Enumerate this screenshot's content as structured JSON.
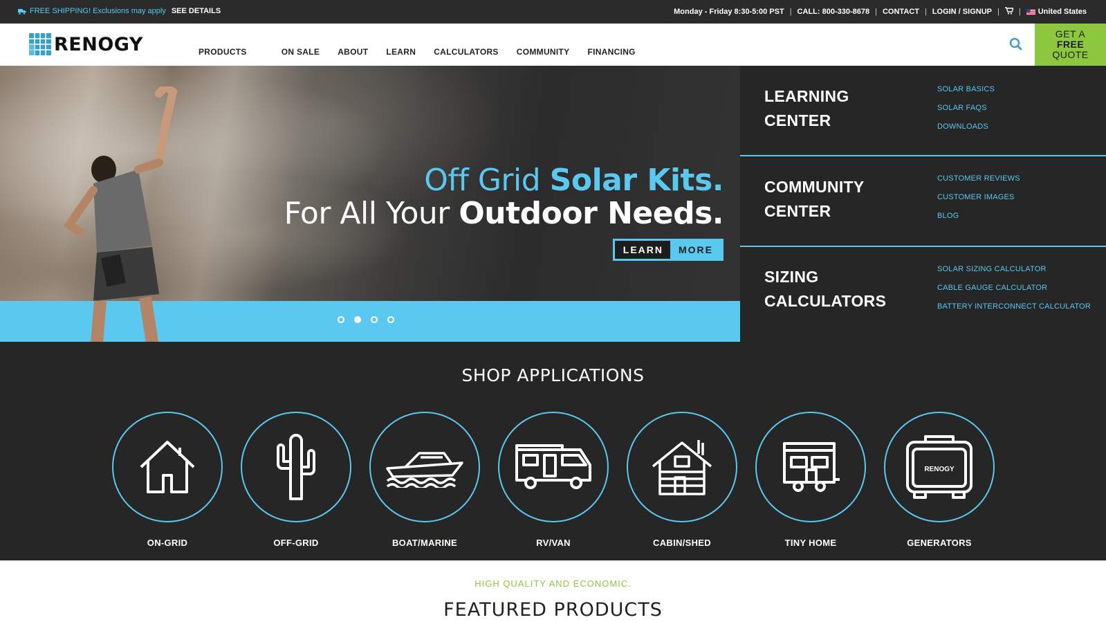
{
  "topbar": {
    "shipping_text": "FREE SHIPPING! Exclusions may apply",
    "details_link": "SEE DETAILS",
    "hours": "Monday - Friday 8:30-5:00 PST",
    "phone": "CALL: 800-330-8678",
    "contact": "CONTACT",
    "login": "LOGIN / SIGNUP",
    "country": "United States",
    "separator": "|"
  },
  "header": {
    "logo_text": "RENOGY",
    "nav": [
      "PRODUCTS",
      "ON SALE",
      "ABOUT",
      "LEARN",
      "CALCULATORS",
      "COMMUNITY",
      "FINANCING"
    ],
    "quote": {
      "line1": "GET A",
      "line2": "FREE",
      "line3": "QUOTE"
    }
  },
  "hero": {
    "line1_light": "Off Grid ",
    "line1_bold": "Solar Kits.",
    "line2_light": "For All Your ",
    "line2_bold": "Outdoor Needs.",
    "cta_left": "LEARN",
    "cta_right": "MORE",
    "slides_total": 4,
    "active_slide": 2
  },
  "side_panel": [
    {
      "title_1": "LEARNING",
      "title_2": "CENTER",
      "links": [
        "SOLAR BASICS",
        "SOLAR FAQS",
        "DOWNLOADS"
      ]
    },
    {
      "title_1": "COMMUNITY",
      "title_2": "CENTER",
      "links": [
        "CUSTOMER REVIEWS",
        "CUSTOMER IMAGES",
        "BLOG"
      ]
    },
    {
      "title_1": "SIZING",
      "title_2": "CALCULATORS",
      "links": [
        "SOLAR SIZING CALCULATOR",
        "CABLE GAUGE CALCULATOR",
        "BATTERY INTERCONNECT CALCULATOR"
      ]
    }
  ],
  "shop": {
    "title": "SHOP APPLICATIONS",
    "apps": [
      {
        "label": "ON-GRID",
        "icon": "house-icon"
      },
      {
        "label": "OFF-GRID",
        "icon": "cactus-icon"
      },
      {
        "label": "BOAT/MARINE",
        "icon": "boat-icon"
      },
      {
        "label": "RV/VAN",
        "icon": "rv-icon"
      },
      {
        "label": "CABIN/SHED",
        "icon": "cabin-icon"
      },
      {
        "label": "TINY HOME",
        "icon": "tiny-home-icon"
      },
      {
        "label": "GENERATORS",
        "icon": "generator-icon"
      }
    ],
    "generator_brand": "RENOGY"
  },
  "featured": {
    "tagline": "HIGH QUALITY AND ECONOMIC.",
    "title": "FEATURED PRODUCTS"
  },
  "colors": {
    "accent": "#5ac8ef",
    "green": "#8dc63f",
    "dark": "#262626"
  }
}
